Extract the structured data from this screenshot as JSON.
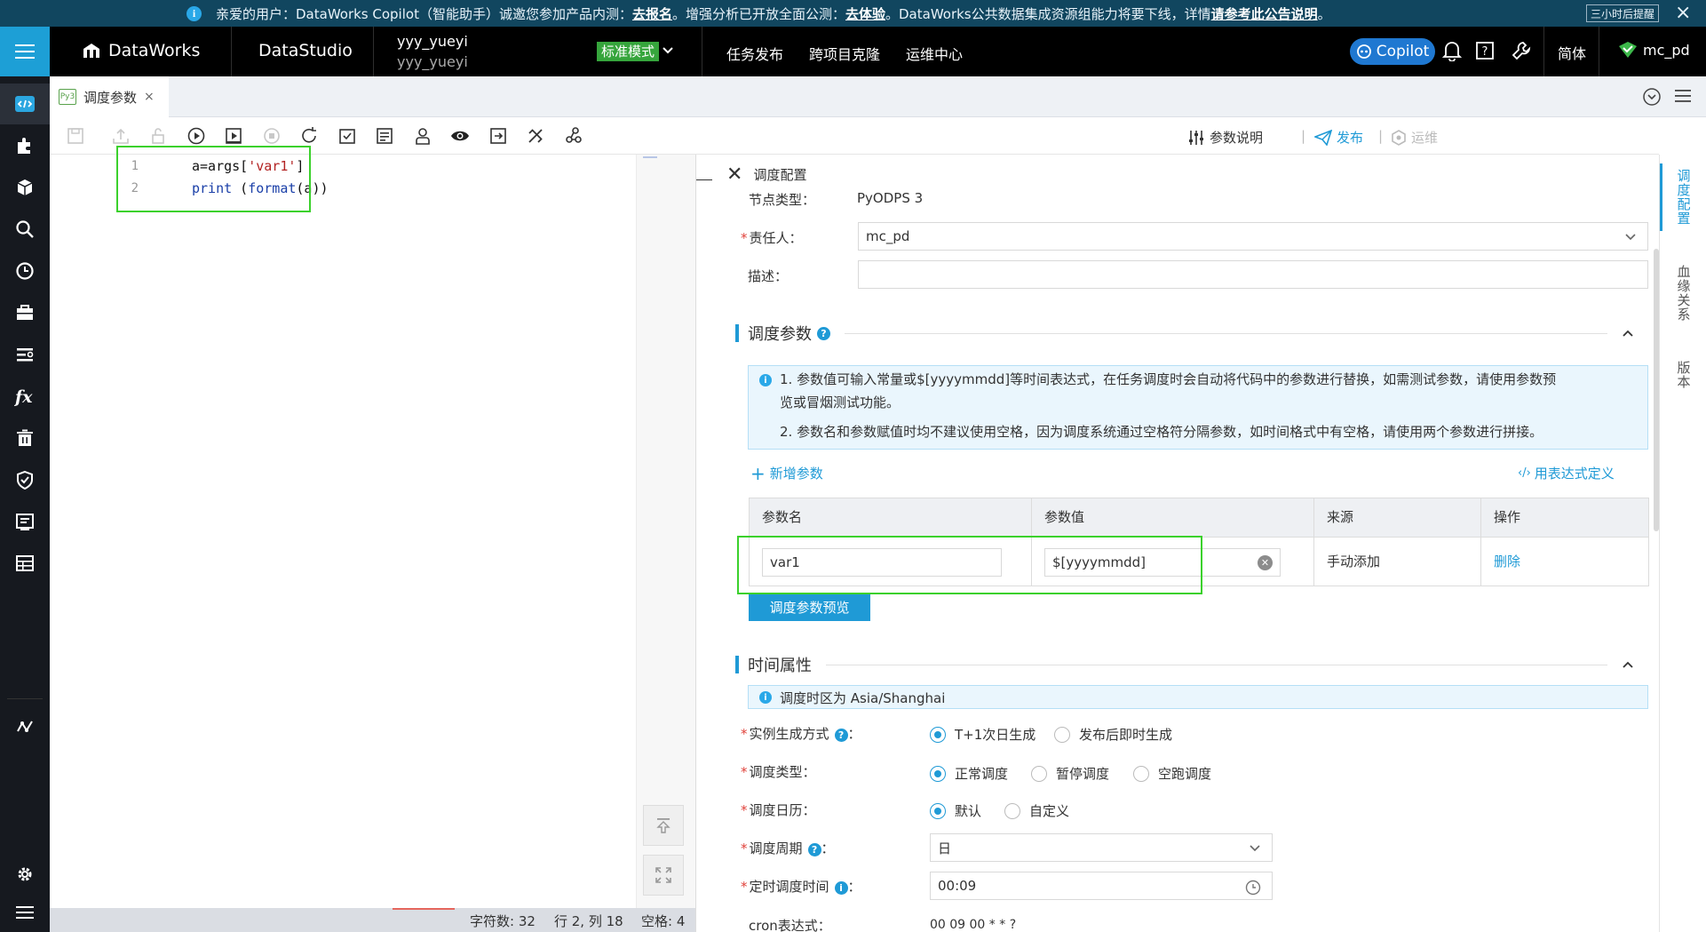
{
  "notice": {
    "text_prefix": "亲爱的用户：DataWorks Copilot（智能助手）诚邀您参加产品内测：",
    "link1": "去报名",
    "text_mid": "。增强分析已开放全面公测：",
    "link2": "去体验",
    "text_mid2": "。DataWorks公共数据集成资源组能力将要下线，详情",
    "link3": "请参考此公告说明",
    "text_end": "。",
    "remind_label": "三小时后提醒",
    "close": "×"
  },
  "topnav": {
    "brand": "DataWorks",
    "studio": "DataStudio",
    "workspace_name": "yyy_yueyi",
    "workspace_sub": "yyy_yueyi",
    "mode": "标准模式",
    "links": [
      "任务发布",
      "跨项目克隆",
      "运维中心"
    ],
    "copilot": "Copilot",
    "lang": "简体",
    "user": "mc_pd"
  },
  "tab": {
    "badge": "Py3",
    "label": "调度参数",
    "close": "×"
  },
  "toolbar": {
    "param_doc": "参数说明",
    "publish": "发布",
    "ops": "运维",
    "sep": "|"
  },
  "editor": {
    "line_numbers": [
      "1",
      "2"
    ],
    "lines": [
      {
        "a": "a=args[",
        "s": "'var1'",
        "b": "]"
      },
      {
        "kw": "print",
        "mid": " (",
        "fn": "format",
        "end": "(a))"
      }
    ]
  },
  "statusbar": {
    "chars": "字符数: 32",
    "pos": "行 2, 列 18",
    "spaces": "空格: 4"
  },
  "panel": {
    "title": "调度配置",
    "node_type_label": "节点类型：",
    "node_type_value": "PyODPS 3",
    "owner_label": "责任人：",
    "owner_value": "mc_pd",
    "desc_label": "描述：",
    "desc_value": "",
    "req": "*",
    "sched_params": {
      "title": "调度参数",
      "info1a": "1. 参数值可输入常量或$[yyyymmdd]等时间表达式，在任务调度时会自动将代码中的参数进行替换，如需测试参数，请使用参数预",
      "info1b": "览或冒烟测试功能。",
      "info2": "2. 参数名和参数赋值时均不建议使用空格，因为调度系统通过空格符分隔参数，如时间格式中有空格，请使用两个参数进行拼接。",
      "add": "新增参数",
      "expr": "用表达式定义",
      "headers": [
        "参数名",
        "参数值",
        "来源",
        "操作"
      ],
      "row": {
        "name": "var1",
        "value": "$[yyyymmdd]",
        "source": "手动添加",
        "action": "删除"
      },
      "preview": "调度参数预览"
    },
    "time": {
      "title": "时间属性",
      "tz": "调度时区为 Asia/Shanghai",
      "gen_label": "实例生成方式",
      "gen_opts": [
        "T+1次日生成",
        "发布后即时生成"
      ],
      "type_label": "调度类型：",
      "type_opts": [
        "正常调度",
        "暂停调度",
        "空跑调度"
      ],
      "cal_label": "调度日历：",
      "cal_opts": [
        "默认",
        "自定义"
      ],
      "cycle_label": "调度周期",
      "cycle_value": "日",
      "timer_label": "定时调度时间",
      "timer_value": "00:09",
      "cron_label": "cron表达式：",
      "cron_value": "00 09 00 * * ?",
      "colon": "："
    }
  },
  "sidetabs": [
    "调度配置",
    "血缘关系",
    "版本"
  ],
  "colors": {
    "accent": "#1f9ad6",
    "topnav_bg": "#000000",
    "notice_bg": "#11465f",
    "highlight_box": "#3bd12c",
    "mode_badge": "#36a53c",
    "copilot": "#1f78d1"
  }
}
